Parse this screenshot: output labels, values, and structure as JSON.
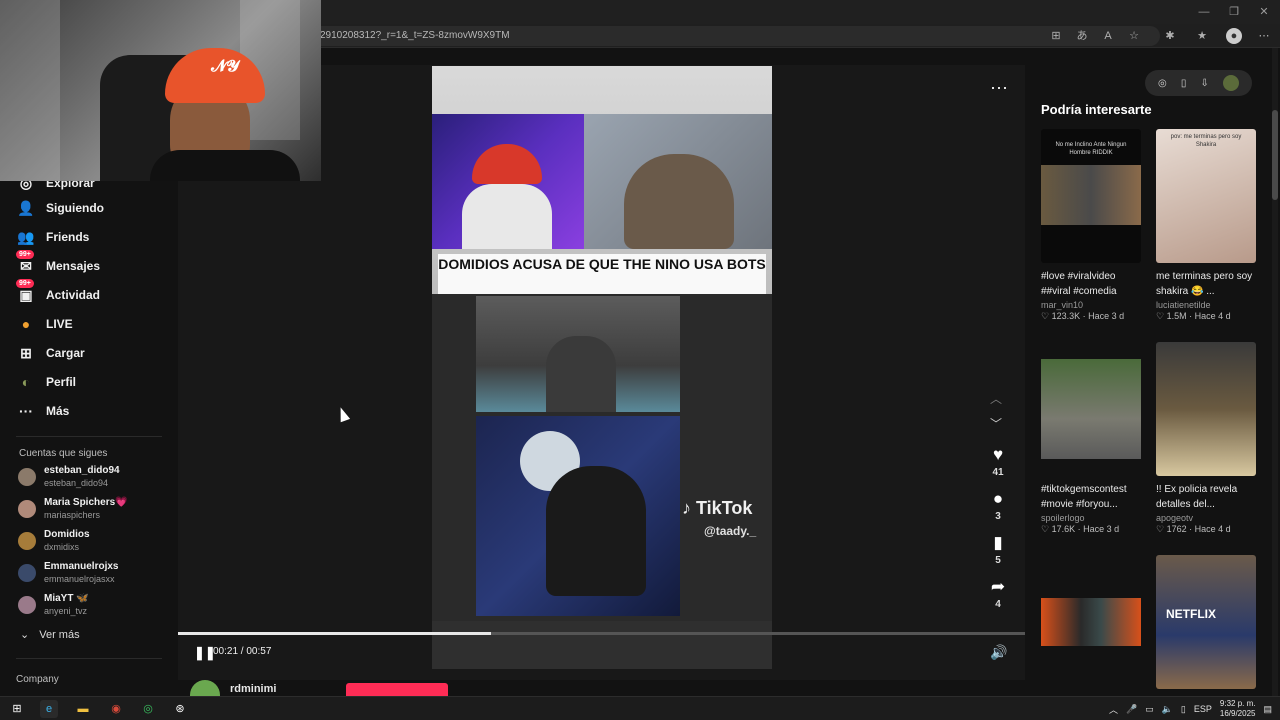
{
  "browser": {
    "url": "2910208312?_r=1&_t=ZS-8zmovW9X9TM",
    "window_controls": [
      "—",
      "❐",
      "✕"
    ]
  },
  "sidebar": {
    "items": [
      {
        "label": "Explorar",
        "icon": "compass-icon",
        "glyph": "◎",
        "badge": ""
      },
      {
        "label": "Siguiendo",
        "icon": "user-follow-icon",
        "glyph": "👤",
        "badge": ""
      },
      {
        "label": "Friends",
        "icon": "friends-icon",
        "glyph": "👥",
        "badge": ""
      },
      {
        "label": "Mensajes",
        "icon": "message-icon",
        "glyph": "✉",
        "badge": "99+"
      },
      {
        "label": "Actividad",
        "icon": "inbox-icon",
        "glyph": "▣",
        "badge": "99+"
      },
      {
        "label": "LIVE",
        "icon": "live-icon",
        "glyph": "●",
        "badge": ""
      },
      {
        "label": "Cargar",
        "icon": "upload-icon",
        "glyph": "⊞",
        "badge": ""
      },
      {
        "label": "Perfil",
        "icon": "profile-icon",
        "glyph": "◐",
        "badge": ""
      },
      {
        "label": "Más",
        "icon": "more-icon",
        "glyph": "···",
        "badge": ""
      }
    ],
    "following_title": "Cuentas que sigues",
    "accounts": [
      {
        "name": "esteban_dido94",
        "handle": "esteban_dido94",
        "color": "#8b7a6a"
      },
      {
        "name": "Maria Spichers💗",
        "handle": "mariaspichers",
        "color": "#b08a7a"
      },
      {
        "name": "Domidios",
        "handle": "dxmidixs",
        "color": "#a67c3a"
      },
      {
        "name": "Emmanuelrojxs",
        "handle": "emmanuelrojasxx",
        "color": "#3a4a6a"
      },
      {
        "name": "MiaYT 🦋",
        "handle": "anyeni_tvz",
        "color": "#9a7a8a"
      }
    ],
    "see_more": "Ver más",
    "company": "Company"
  },
  "video": {
    "caption_text": "DOMIDIOS ACUSA DE QUE THE NINO USA BOTS",
    "watermark": "TikTok",
    "watermark_handle": "@taady._",
    "time": "00:21 / 00:57",
    "progress": 0.37,
    "actions": [
      {
        "name": "like",
        "icon": "heart-icon",
        "glyph": "♥",
        "count": "41"
      },
      {
        "name": "comment",
        "icon": "comment-icon",
        "glyph": "●",
        "count": "3"
      },
      {
        "name": "bookmark",
        "icon": "bookmark-icon",
        "glyph": "▮",
        "count": "5"
      },
      {
        "name": "share",
        "icon": "share-icon",
        "glyph": "➦",
        "count": "4"
      }
    ],
    "author": "rdminimi"
  },
  "recommendations": {
    "title": "Podría interesarte",
    "cards": [
      {
        "title": "#love #viralvideo ##viral #comedia",
        "author": "mar_vin10",
        "stats": "♡ 123.3K · Hace 3 d",
        "thumb_text": "No me Inclino Ante Ningun Hombre RIDDIK",
        "c1": "#0a0a0a",
        "c2": "#6a5a40"
      },
      {
        "title": "me terminas pero soy shakira 😂 ...",
        "author": "luciatienetilde",
        "stats": "♡ 1.5M · Hace 4 d",
        "thumb_text": "pov: me terminas pero soy Shakira",
        "c1": "#d8c8c0",
        "c2": "#a07a6a"
      },
      {
        "title": "#tiktokgemscontest #movie #foryou...",
        "author": "spoilerlogo",
        "stats": "♡ 17.6K · Hace 3 d",
        "thumb_text": "",
        "c1": "#5a7a4a",
        "c2": "#6a6a6a"
      },
      {
        "title": "!! Ex policia revela detalles del...",
        "author": "apogeotv",
        "stats": "♡ 1762 · Hace 4 d",
        "thumb_text": "",
        "c1": "#3a3a3a",
        "c2": "#d8c8a0"
      },
      {
        "title": "",
        "author": "",
        "stats": "",
        "thumb_text": "",
        "c1": "#1a1a1a",
        "c2": "#d8501a"
      },
      {
        "title": "",
        "author": "",
        "stats": "",
        "thumb_text": "NETFLIX",
        "c1": "#2a3a6a",
        "c2": "#8a6a4a"
      }
    ]
  },
  "taskbar": {
    "lang": "ESP",
    "time": "9:32 p. m.",
    "date": "16/9/2025"
  }
}
